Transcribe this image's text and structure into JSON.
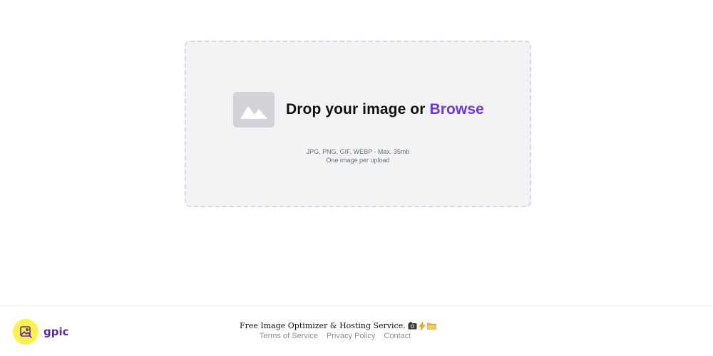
{
  "dropzone": {
    "prompt": "Drop your image or ",
    "browse_label": "Browse",
    "formats": "JPG, PNG, GIF, WEBP - Max. 35mb",
    "limit": "One image per upload",
    "accent_color": "#6d35e3"
  },
  "footer": {
    "brand_name": "gpic",
    "brand_color": "#5b2aa6",
    "badge_color": "#fbf24b",
    "tagline": "Free Image Optimizer & Hosting Service.",
    "tagline_icons": [
      "camera-icon",
      "lightning-icon",
      "folder-icon"
    ],
    "links": [
      "Terms of Service",
      "Privacy Policy",
      "Contact"
    ]
  }
}
